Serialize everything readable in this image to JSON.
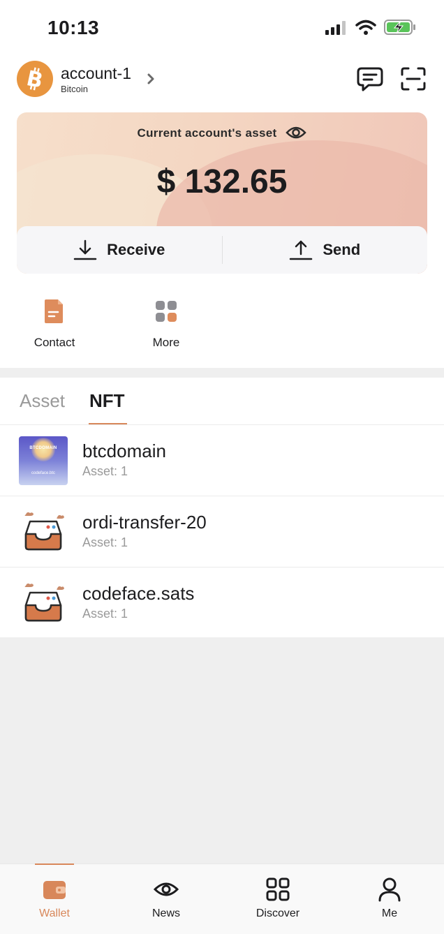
{
  "status_bar": {
    "time": "10:13"
  },
  "header": {
    "account_name": "account-1",
    "chain": "Bitcoin",
    "icons": [
      "bitcoin-logo",
      "chevron-right-icon",
      "message-icon",
      "scan-icon"
    ]
  },
  "asset_card": {
    "label": "Current account's asset",
    "amount": "$ 132.65",
    "receive_label": "Receive",
    "send_label": "Send"
  },
  "quick_actions": [
    {
      "label": "Contact",
      "icon": "contact-document-icon"
    },
    {
      "label": "More",
      "icon": "more-grid-icon"
    }
  ],
  "tabs": [
    {
      "label": "Asset",
      "active": false
    },
    {
      "label": "NFT",
      "active": true
    }
  ],
  "nft_list": [
    {
      "name": "btcdomain",
      "sub": "Asset: 1",
      "thumb_title": "BTCDOMAIN",
      "thumb_sub": "codeface.btc"
    },
    {
      "name": "ordi-transfer-20",
      "sub": "Asset: 1"
    },
    {
      "name": "codeface.sats",
      "sub": "Asset: 1"
    }
  ],
  "bottom_nav": [
    {
      "label": "Wallet",
      "icon": "wallet-icon",
      "active": true
    },
    {
      "label": "News",
      "icon": "eye-icon",
      "active": false
    },
    {
      "label": "Discover",
      "icon": "discover-grid-icon",
      "active": false
    },
    {
      "label": "Me",
      "icon": "user-icon",
      "active": false
    }
  ],
  "colors": {
    "accent": "#d8875a",
    "bitcoin_orange": "#e8953f",
    "card_gradient_start": "#f6dfcb",
    "card_gradient_end": "#f0c6b8"
  }
}
